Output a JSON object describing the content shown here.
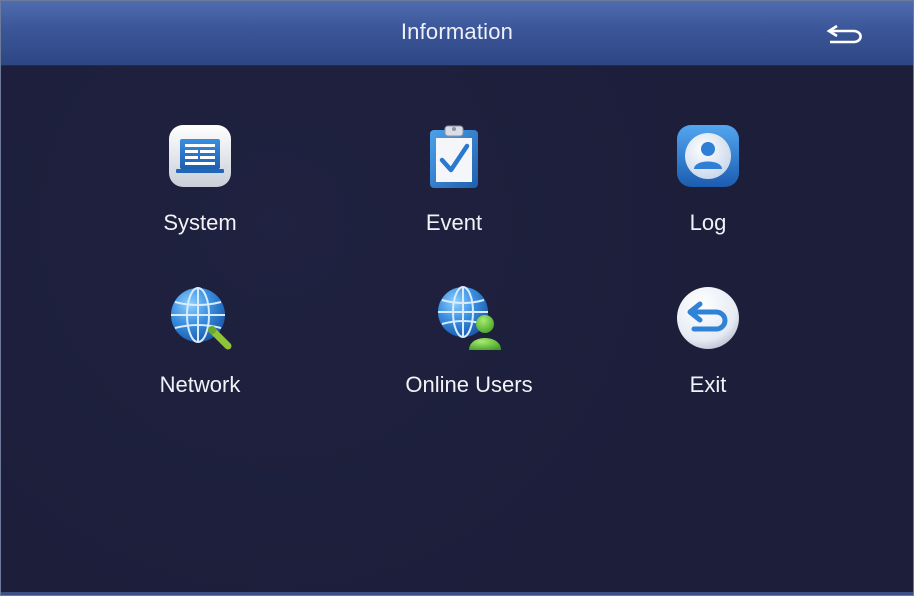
{
  "header": {
    "title": "Information",
    "back_icon": "return-arrow-icon"
  },
  "menu": {
    "items": [
      {
        "label": "System",
        "icon": "system-monitor-icon"
      },
      {
        "label": "Event",
        "icon": "clipboard-check-icon"
      },
      {
        "label": "Log",
        "icon": "log-user-icon"
      },
      {
        "label": "Network",
        "icon": "globe-search-icon"
      },
      {
        "label": "Online Users",
        "icon": "globe-users-icon"
      },
      {
        "label": "Exit",
        "icon": "exit-return-icon"
      }
    ]
  },
  "colors": {
    "background": "#1c1e3a",
    "titlebar": "#3b5698",
    "text": "#f2f3f8",
    "icon_blue": "#2f82d6",
    "icon_green": "#5fc23c"
  }
}
